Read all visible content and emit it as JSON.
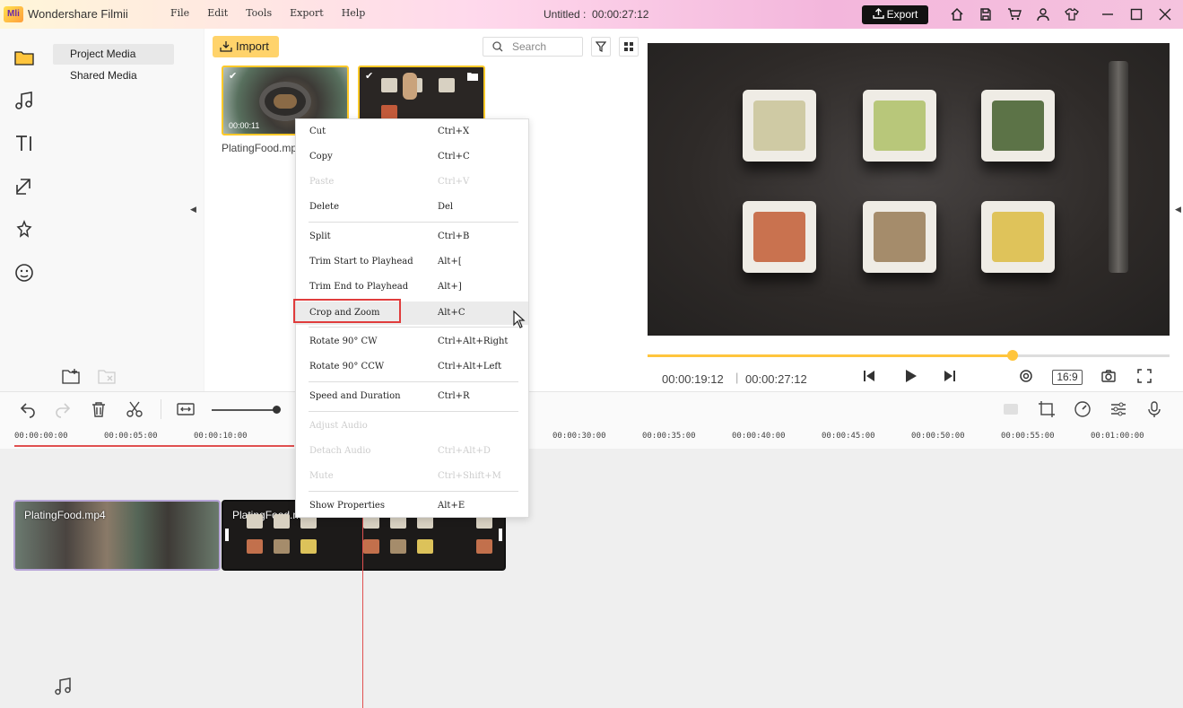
{
  "app": {
    "logo": "Mli",
    "name": "Wondershare Filmii",
    "doc_title": "Untitled :",
    "doc_time": "00:00:27:12",
    "export_label": "Export"
  },
  "menu": [
    "File",
    "Edit",
    "Tools",
    "Export",
    "Help"
  ],
  "categories": {
    "project": "Project Media",
    "shared": "Shared Media"
  },
  "media": {
    "import_label": "Import",
    "search_placeholder": "Search",
    "clip1_time": "00:00:11",
    "clip1_name": "PlatingFood.mp"
  },
  "preview": {
    "current_time": "00:00:19:12",
    "separator": "|",
    "total_time": "00:00:27:12",
    "ratio": "16:9",
    "progress_fraction": 0.7
  },
  "ruler": [
    "00:00:00:00",
    "00:00:05:00",
    "00:00:10:00",
    "00:00:30:00",
    "00:00:35:00",
    "00:00:40:00",
    "00:00:45:00",
    "00:00:50:00",
    "00:00:55:00",
    "00:01:00:00"
  ],
  "timeline": {
    "clip1_label": "PlatingFood.mp4",
    "clip2_label": "PlatingFood.mp4"
  },
  "context_menu": {
    "cut": {
      "label": "Cut",
      "shortcut": "Ctrl+X"
    },
    "copy": {
      "label": "Copy",
      "shortcut": "Ctrl+C"
    },
    "paste": {
      "label": "Paste",
      "shortcut": "Ctrl+V"
    },
    "delete": {
      "label": "Delete",
      "shortcut": "Del"
    },
    "split": {
      "label": "Split",
      "shortcut": "Ctrl+B"
    },
    "trim_start": {
      "label": "Trim Start to Playhead",
      "shortcut": "Alt+["
    },
    "trim_end": {
      "label": "Trim End to Playhead",
      "shortcut": "Alt+]"
    },
    "crop": {
      "label": "Crop and Zoom",
      "shortcut": "Alt+C"
    },
    "rotate_cw": {
      "label": "Rotate 90° CW",
      "shortcut": "Ctrl+Alt+Right"
    },
    "rotate_ccw": {
      "label": "Rotate 90° CCW",
      "shortcut": "Ctrl+Alt+Left"
    },
    "speed": {
      "label": "Speed and Duration",
      "shortcut": "Ctrl+R"
    },
    "adjust_audio": {
      "label": "Adjust Audio",
      "shortcut": ""
    },
    "detach_audio": {
      "label": "Detach Audio",
      "shortcut": "Ctrl+Alt+D"
    },
    "mute": {
      "label": "Mute",
      "shortcut": "Ctrl+Shift+M"
    },
    "properties": {
      "label": "Show Properties",
      "shortcut": "Alt+E"
    }
  },
  "colors": {
    "accent": "#ffc53d",
    "playhead": "#e05050",
    "highlight_box": "#e03c3c"
  }
}
